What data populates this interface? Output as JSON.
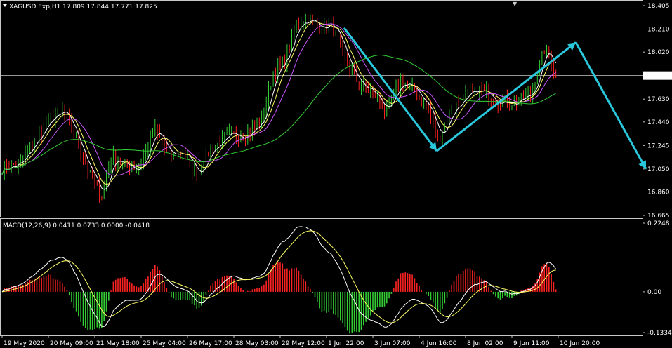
{
  "chart_data": [
    {
      "type": "candlestick",
      "title": "XAGUSD.Exp,H1  17.809 17.844 17.771 17.825",
      "symbol": "XAGUSD.Exp,H1",
      "ohlc_last": {
        "open": 17.809,
        "high": 17.844,
        "low": 17.771,
        "close": 17.825
      },
      "ylim": [
        16.665,
        18.405
      ],
      "yticks": [
        18.405,
        18.21,
        18.02,
        17.825,
        17.63,
        17.44,
        17.245,
        17.05,
        16.86,
        16.665
      ],
      "ytick_labels": [
        "18.405",
        "18.210",
        "18.020",
        "17.825",
        "17.630",
        "17.440",
        "17.245",
        "17.050",
        "16.860",
        "16.665"
      ],
      "current_price": 17.825,
      "current_price_label": "17.825",
      "path_anchors": [
        {
          "i": 0,
          "v": 17.05
        },
        {
          "i": 8,
          "v": 17.1
        },
        {
          "i": 14,
          "v": 17.28
        },
        {
          "i": 20,
          "v": 17.45
        },
        {
          "i": 26,
          "v": 17.53
        },
        {
          "i": 32,
          "v": 17.3
        },
        {
          "i": 38,
          "v": 17.0
        },
        {
          "i": 43,
          "v": 16.82
        },
        {
          "i": 47,
          "v": 17.15
        },
        {
          "i": 53,
          "v": 17.08
        },
        {
          "i": 59,
          "v": 17.05
        },
        {
          "i": 66,
          "v": 17.38
        },
        {
          "i": 72,
          "v": 17.15
        },
        {
          "i": 78,
          "v": 17.2
        },
        {
          "i": 84,
          "v": 17.0
        },
        {
          "i": 90,
          "v": 17.22
        },
        {
          "i": 98,
          "v": 17.32
        },
        {
          "i": 106,
          "v": 17.35
        },
        {
          "i": 112,
          "v": 17.44
        },
        {
          "i": 117,
          "v": 17.85
        },
        {
          "i": 122,
          "v": 17.95
        },
        {
          "i": 127,
          "v": 18.25
        },
        {
          "i": 132,
          "v": 18.3
        },
        {
          "i": 137,
          "v": 18.22
        },
        {
          "i": 142,
          "v": 18.26
        },
        {
          "i": 148,
          "v": 17.95
        },
        {
          "i": 154,
          "v": 17.75
        },
        {
          "i": 160,
          "v": 17.68
        },
        {
          "i": 166,
          "v": 17.52
        },
        {
          "i": 172,
          "v": 17.78
        },
        {
          "i": 178,
          "v": 17.7
        },
        {
          "i": 184,
          "v": 17.55
        },
        {
          "i": 188,
          "v": 17.3
        },
        {
          "i": 194,
          "v": 17.55
        },
        {
          "i": 200,
          "v": 17.65
        },
        {
          "i": 207,
          "v": 17.7
        },
        {
          "i": 214,
          "v": 17.62
        },
        {
          "i": 220,
          "v": 17.6
        },
        {
          "i": 228,
          "v": 17.66
        },
        {
          "i": 234,
          "v": 18.05
        },
        {
          "i": 237,
          "v": 17.95
        },
        {
          "i": 239,
          "v": 17.825
        }
      ],
      "moving_averages": [
        {
          "name": "ma-fast",
          "period": 5,
          "color": "#ffffff"
        },
        {
          "name": "ma-yellow",
          "period": 8,
          "color": "#ffff66"
        },
        {
          "name": "ma-purple",
          "period": 14,
          "color": "#cc55ff"
        },
        {
          "name": "ma-green",
          "period": 50,
          "color": "#33cc33"
        }
      ],
      "annotations": [
        {
          "type": "arrow",
          "color": "#29c8dc",
          "points": [
            [
              "1 Jun 22:00",
              18.22
            ],
            [
              "4 Jun 16:00",
              17.2
            ]
          ]
        },
        {
          "type": "arrow",
          "color": "#29c8dc",
          "points": [
            [
              "4 Jun 16:00",
              17.2
            ],
            [
              "10 Jun 20:00",
              18.1
            ]
          ]
        },
        {
          "type": "arrow",
          "color": "#29c8dc",
          "points": [
            [
              "10 Jun 20:00",
              18.1
            ],
            [
              "beyond",
              17.05
            ]
          ]
        }
      ],
      "colors": {
        "bull": "#33cc33",
        "bear": "#ff2222",
        "arrow": "#29c8dc",
        "grid": "#c8c8c8"
      }
    },
    {
      "type": "macd",
      "title": "MACD(12,26,9) 0.0411 0.0733 0.0000 -0.0418",
      "params": [
        12,
        26,
        9
      ],
      "values": {
        "histogram": 0.0411,
        "signal": 0.0733,
        "v3": 0.0,
        "v4": -0.0418
      },
      "ylim": [
        -0.1334,
        0.2248
      ],
      "yticks": [
        0.2248,
        0.0,
        -0.1334
      ],
      "ytick_labels": [
        "0.2248",
        "0.00",
        "-0.1334"
      ],
      "colors": {
        "hist_pos": "#ff2222",
        "hist_neg": "#33cc33",
        "macd": "#ffffff",
        "signal": "#ffff66"
      }
    }
  ],
  "x_axis": {
    "labels": [
      "19 May 2020",
      "20 May 09:00",
      "21 May 18:00",
      "25 May 04:00",
      "26 May 17:00",
      "28 May 03:00",
      "29 May 12:00",
      "1 Jun 22:00",
      "3 Jun 07:00",
      "4 Jun 16:00",
      "8 Jun 02:00",
      "9 Jun 11:00",
      "10 Jun 20:00"
    ],
    "label_bar_index": [
      0,
      20,
      40,
      60,
      80,
      100,
      120,
      140,
      160,
      180,
      200,
      220,
      240
    ]
  },
  "top_marker": "▼"
}
